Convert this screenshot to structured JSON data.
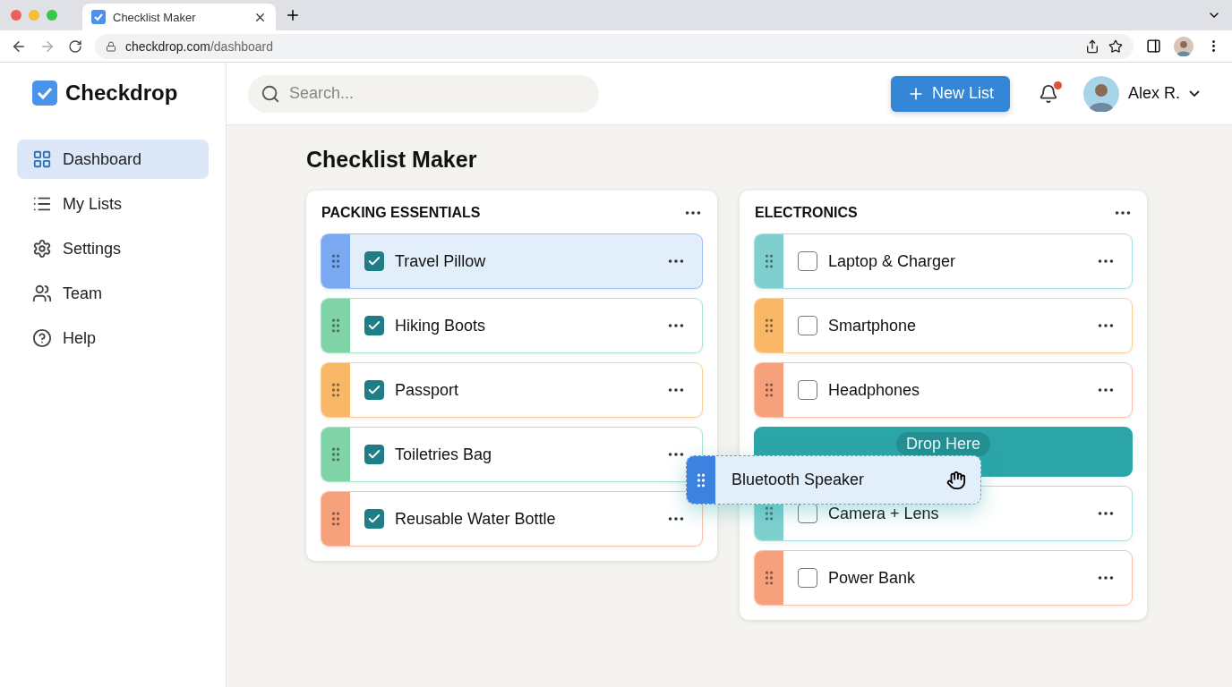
{
  "browser": {
    "tab_title": "Checklist Maker",
    "url_host": "checkdrop.com",
    "url_path": "/dashboard"
  },
  "app": {
    "logo": "Checkdrop"
  },
  "sidebar": {
    "items": [
      {
        "label": "Dashboard",
        "selected": true
      },
      {
        "label": "My Lists",
        "selected": false
      },
      {
        "label": "Settings",
        "selected": false
      },
      {
        "label": "Team",
        "selected": false
      },
      {
        "label": "Help",
        "selected": false
      }
    ]
  },
  "header": {
    "search": {
      "placeholder": "Search..."
    },
    "new_button": "New List",
    "notification_dot": true,
    "user": "Alex R."
  },
  "page_title": "Checklist Maker",
  "lists": [
    {
      "title": "PACKING ESSENTIALS",
      "items": [
        {
          "kind": "item",
          "label": "Travel Pillow",
          "checked": true,
          "selected": true,
          "color": "#7aa9f2"
        },
        {
          "kind": "item",
          "label": "Hiking Boots",
          "checked": true,
          "selected": false,
          "color": "#7fd3a6"
        },
        {
          "kind": "item",
          "label": "Passport",
          "checked": true,
          "selected": false,
          "color": "#f8b868"
        },
        {
          "kind": "item",
          "label": "Toiletries Bag",
          "checked": true,
          "selected": false,
          "color": "#7fd3a6"
        },
        {
          "kind": "item",
          "label": "Reusable Water Bottle",
          "checked": true,
          "selected": false,
          "color": "#f7a07c"
        }
      ]
    },
    {
      "title": "ELECTRONICS",
      "items": [
        {
          "kind": "item",
          "label": "Laptop & Charger",
          "checked": false,
          "selected": false,
          "color": "#80cfcf"
        },
        {
          "kind": "item",
          "label": "Smartphone",
          "checked": false,
          "selected": false,
          "color": "#f8b868"
        },
        {
          "kind": "item",
          "label": "Headphones",
          "checked": false,
          "selected": false,
          "color": "#f7a07c"
        },
        {
          "kind": "drop-zone",
          "label": "Drop Here"
        },
        {
          "kind": "item",
          "label": "Camera + Lens",
          "checked": false,
          "selected": false,
          "color": "#80cfcf"
        },
        {
          "kind": "item",
          "label": "Power Bank",
          "checked": false,
          "selected": false,
          "color": "#f7a07c"
        }
      ]
    }
  ],
  "dragging": {
    "label": "Bluetooth Speaker"
  }
}
